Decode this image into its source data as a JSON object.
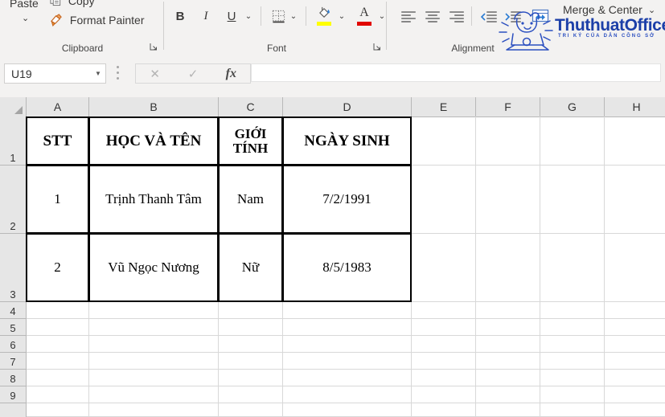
{
  "ribbon": {
    "clipboard": {
      "group_label": "Clipboard",
      "paste_label": "Paste",
      "paste_chevron": "chevron-down-icon",
      "copy_label": "Copy",
      "format_painter_label": "Format Painter",
      "dialog_launcher": "↘"
    },
    "font": {
      "group_label": "Font",
      "bold_label": "B",
      "italic_label": "I",
      "underline_label": "U",
      "underline_chevron": "ˇ",
      "borders_chevron": "ˇ",
      "fill_color_chevron": "ˇ",
      "font_color_label": "A",
      "font_color_chevron": "ˇ",
      "fill_color_hex": "#ffff00",
      "font_color_hex": "#e10600",
      "dialog_launcher": "↘"
    },
    "alignment": {
      "group_label": "Alignment",
      "align_left": "align-left-icon",
      "align_center": "align-center-icon",
      "align_right": "align-right-icon",
      "decrease_indent": "decrease-indent-icon",
      "increase_indent": "increase-indent-icon",
      "merge_center_label": "Merge & Center",
      "merge_chevron": "ˇ"
    }
  },
  "watermark": {
    "brand": "ThuthuatOffice",
    "tagline": "TRI KỶ CỦA DÂN CÔNG SỞ",
    "brand_color": "#1c3fa8"
  },
  "formula_bar": {
    "name_box_value": "U19",
    "name_box_arrow": "▼",
    "cancel_label": "✕",
    "confirm_label": "✓",
    "insert_function_label": "fx",
    "formula_value": ""
  },
  "grid": {
    "columns": [
      "A",
      "B",
      "C",
      "D",
      "E",
      "F",
      "G",
      "H"
    ],
    "rows": [
      "1",
      "2",
      "3",
      "4",
      "5",
      "6",
      "7",
      "8",
      "9"
    ]
  },
  "table": {
    "headers": [
      "STT",
      "HỌc VÀ TÊN",
      "GIỚI TÍNH",
      "NGÀY SINH"
    ],
    "header_stt": "STT",
    "header_name": "HỌC VÀ TÊN",
    "header_gender": "GIỚI TÍNH",
    "header_dob": "NGÀY SINH",
    "rows": [
      {
        "stt": "1",
        "name": "Trịnh Thanh Tâm",
        "gender": "Nam",
        "dob": "7/2/1991"
      },
      {
        "stt": "2",
        "name": "Vũ Ngọc Nương",
        "gender": "Nữ",
        "dob": "8/5/1983"
      }
    ]
  }
}
